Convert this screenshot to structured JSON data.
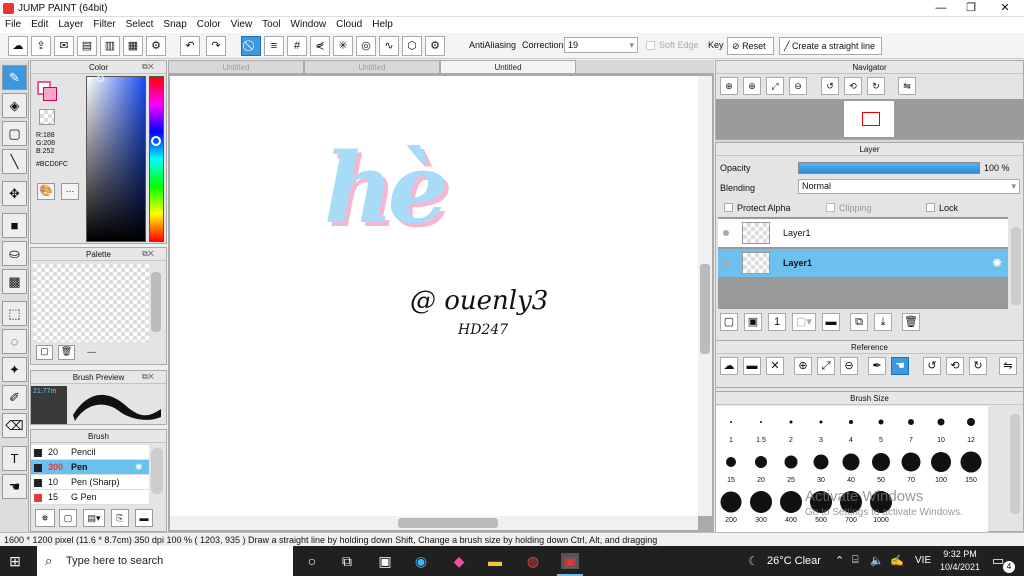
{
  "app": {
    "title": "JUMP PAINT (64bit)"
  },
  "window_controls": {
    "minimize": "—",
    "maximize": "❐",
    "close": "✕"
  },
  "menu": [
    "File",
    "Edit",
    "Layer",
    "Filter",
    "Select",
    "Snap",
    "Color",
    "View",
    "Tool",
    "Window",
    "Cloud",
    "Help"
  ],
  "toolbar": {
    "antialiasing_label": "AntiAliasing",
    "correction_label": "Correction",
    "correction_value": "19",
    "soft_edge_label": "Soft Edge",
    "key_label": "Key",
    "reset_label": "Reset",
    "straight_line_label": "Create a straight line"
  },
  "color_panel": {
    "title": "Color",
    "rgb": {
      "r": "R:188",
      "g": "G:208",
      "b": "B:252"
    },
    "hex": "#BCD0FC",
    "main_color": "#e85a9a",
    "sub_color": "#ffffff"
  },
  "palette_panel": {
    "title": "Palette",
    "dash": "---"
  },
  "brush_preview": {
    "title": "Brush Preview",
    "size": "21.77m"
  },
  "brush_panel": {
    "title": "Brush",
    "items": [
      {
        "size": "20",
        "name": "Pencil",
        "swatch": "#222222"
      },
      {
        "size": "300",
        "name": "Pen",
        "swatch": "#222222"
      },
      {
        "size": "10",
        "name": "Pen (Sharp)",
        "swatch": "#222222"
      },
      {
        "size": "15",
        "name": "G Pen",
        "swatch": "#e53935"
      }
    ]
  },
  "canvas": {
    "tabs": [
      "Untitled",
      "Untitled",
      "Untitled"
    ],
    "active_tab": 2,
    "artwork": {
      "main_text": "hè",
      "handle": "@ ouenly3",
      "sub": "HD247"
    }
  },
  "navigator": {
    "title": "Navigator"
  },
  "layer_panel": {
    "title": "Layer",
    "opacity_label": "Opacity",
    "opacity_value": "100 %",
    "opacity_fraction": 1.0,
    "blending_label": "Blending",
    "blending_value": "Normal",
    "protect_alpha": "Protect Alpha",
    "clipping": "Clipping",
    "lock": "Lock",
    "layers": [
      {
        "name": "Layer1",
        "selected": false
      },
      {
        "name": "Layer1",
        "selected": true
      }
    ]
  },
  "reference": {
    "title": "Reference"
  },
  "brush_size": {
    "title": "Brush Size",
    "rows": [
      [
        "1",
        "1.5",
        "2",
        "3",
        "4",
        "5",
        "7",
        "10",
        "12"
      ],
      [
        "15",
        "20",
        "25",
        "30",
        "40",
        "50",
        "70",
        "100",
        "150"
      ],
      [
        "200",
        "300",
        "400",
        "500",
        "700",
        "1000"
      ]
    ]
  },
  "status_bar": {
    "text": "1600 * 1200 pixel   (11.6 * 8.7cm)   350 dpi   100 %   ( 1203, 935 )   Draw a straight line by holding down Shift, Change a brush size by holding down Ctrl, Alt, and dragging"
  },
  "watermark": {
    "line1": "Activate Windows",
    "line2": "Go to Settings to activate Windows."
  },
  "taskbar": {
    "search_placeholder": "Type here to search",
    "weather": "26°C  Clear",
    "lang": "VIE",
    "time": "9:32 PM",
    "date": "10/4/2021",
    "notif_count": "4"
  }
}
